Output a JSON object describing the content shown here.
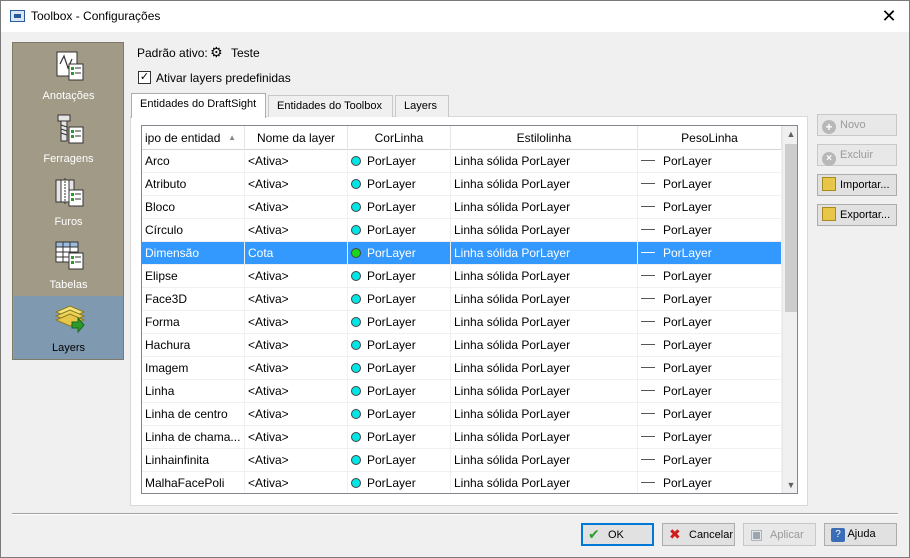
{
  "window": {
    "title": "Toolbox - Configurações"
  },
  "sidebar": {
    "items": [
      {
        "label": "Anotações",
        "icon": "annotations-icon"
      },
      {
        "label": "Ferragens",
        "icon": "hardware-icon"
      },
      {
        "label": "Furos",
        "icon": "holes-icon"
      },
      {
        "label": "Tabelas",
        "icon": "tables-icon"
      },
      {
        "label": "Layers",
        "icon": "layers-icon",
        "active": true
      }
    ]
  },
  "standard": {
    "label": "Padrão ativo:",
    "value": "Teste"
  },
  "activate_layers": {
    "label": "Ativar layers predefinidas",
    "checked": true
  },
  "tabs": [
    {
      "label": "Entidades do DraftSight",
      "active": true
    },
    {
      "label": "Entidades do Toolbox"
    },
    {
      "label": "Layers"
    }
  ],
  "grid": {
    "columns": [
      "ipo de entidad",
      "Nome da layer",
      "CorLinha",
      "Estilolinha",
      "PesoLinha"
    ],
    "rows": [
      {
        "type": "Arco",
        "layer": "<Ativa>",
        "color": "PorLayer",
        "style": "Linha sólida PorLayer",
        "weight": "PorLayer"
      },
      {
        "type": "Atributo",
        "layer": "<Ativa>",
        "color": "PorLayer",
        "style": "Linha sólida PorLayer",
        "weight": "PorLayer"
      },
      {
        "type": "Bloco",
        "layer": "<Ativa>",
        "color": "PorLayer",
        "style": "Linha sólida PorLayer",
        "weight": "PorLayer"
      },
      {
        "type": "Círculo",
        "layer": "<Ativa>",
        "color": "PorLayer",
        "style": "Linha sólida PorLayer",
        "weight": "PorLayer"
      },
      {
        "type": "Dimensão",
        "layer": "Cota",
        "color": "PorLayer",
        "style": "Linha sólida PorLayer",
        "weight": "PorLayer",
        "selected": true
      },
      {
        "type": "Elipse",
        "layer": "<Ativa>",
        "color": "PorLayer",
        "style": "Linha sólida PorLayer",
        "weight": "PorLayer"
      },
      {
        "type": "Face3D",
        "layer": "<Ativa>",
        "color": "PorLayer",
        "style": "Linha sólida PorLayer",
        "weight": "PorLayer"
      },
      {
        "type": "Forma",
        "layer": "<Ativa>",
        "color": "PorLayer",
        "style": "Linha sólida PorLayer",
        "weight": "PorLayer"
      },
      {
        "type": "Hachura",
        "layer": "<Ativa>",
        "color": "PorLayer",
        "style": "Linha sólida PorLayer",
        "weight": "PorLayer"
      },
      {
        "type": "Imagem",
        "layer": "<Ativa>",
        "color": "PorLayer",
        "style": "Linha sólida PorLayer",
        "weight": "PorLayer"
      },
      {
        "type": "Linha",
        "layer": "<Ativa>",
        "color": "PorLayer",
        "style": "Linha sólida PorLayer",
        "weight": "PorLayer"
      },
      {
        "type": "Linha de centro",
        "layer": "<Ativa>",
        "color": "PorLayer",
        "style": "Linha sólida PorLayer",
        "weight": "PorLayer"
      },
      {
        "type": "Linha de chama...",
        "layer": "<Ativa>",
        "color": "PorLayer",
        "style": "Linha sólida PorLayer",
        "weight": "PorLayer"
      },
      {
        "type": "Linhainfinita",
        "layer": "<Ativa>",
        "color": "PorLayer",
        "style": "Linha sólida PorLayer",
        "weight": "PorLayer"
      },
      {
        "type": "MalhaFacePoli",
        "layer": "<Ativa>",
        "color": "PorLayer",
        "style": "Linha sólida PorLayer",
        "weight": "PorLayer"
      }
    ]
  },
  "side_buttons": {
    "new": "Novo",
    "delete": "Excluir",
    "import": "Importar...",
    "export": "Exportar..."
  },
  "footer": {
    "ok": "OK",
    "cancel": "Cancelar",
    "apply": "Aplicar",
    "help": "Ajuda"
  },
  "colors": {
    "sidebar_bg": "#a09a86",
    "sidebar_active": "#7f9ab0",
    "selection": "#3399ff",
    "color_dot": "#00e5e5"
  }
}
